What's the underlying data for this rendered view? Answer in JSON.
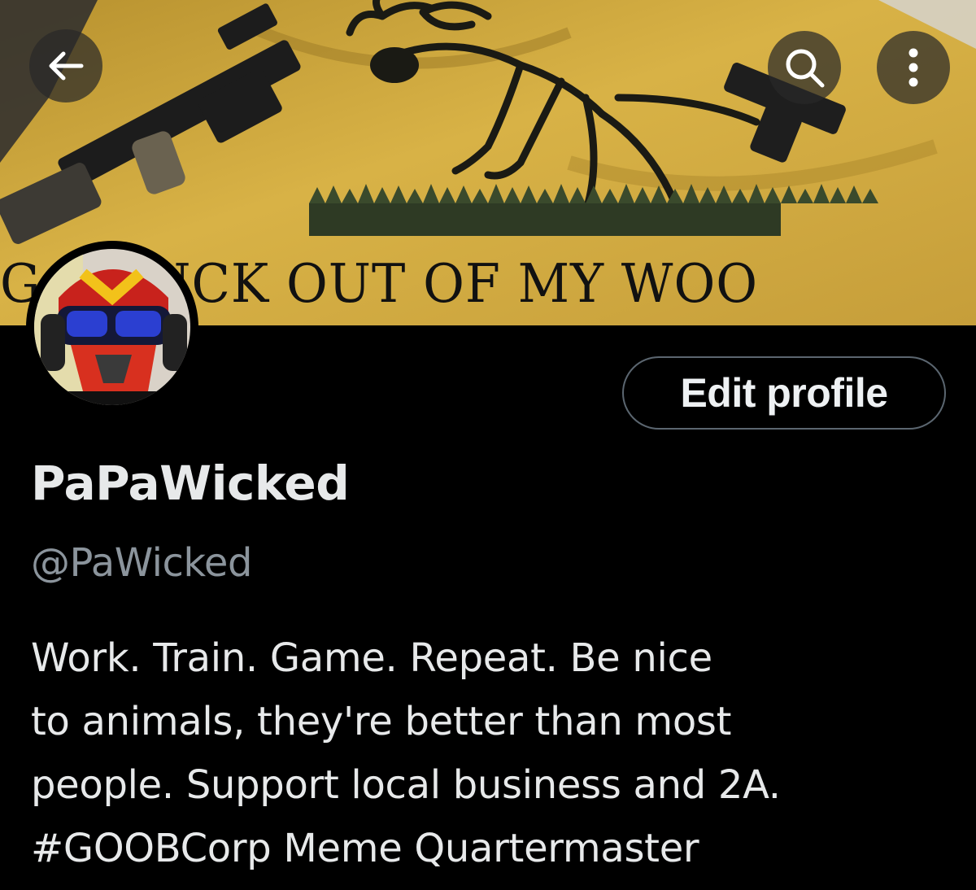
{
  "banner": {
    "text": "GET THE FUCK OUT OF MY WOODS",
    "visible_text": "G    E FUCK OUT OF MY WOO",
    "background_color": "#c9a23a"
  },
  "top_bar": {
    "back_icon": "arrow-left-icon",
    "search_icon": "search-icon",
    "more_icon": "more-vertical-icon"
  },
  "profile": {
    "edit_label": "Edit profile",
    "display_name": "PaPaWicked",
    "handle": "@PaWicked",
    "bio_lines": [
      "Work. Train. Game. Repeat. Be nice",
      "to animals, they're better than most",
      "people. Support local business and 2A.",
      "#GOOBCorp Meme Quartermaster"
    ]
  },
  "colors": {
    "background": "#000000",
    "text_primary": "#e7e9ea",
    "text_secondary": "#8b949c",
    "button_border": "#5b6670"
  }
}
